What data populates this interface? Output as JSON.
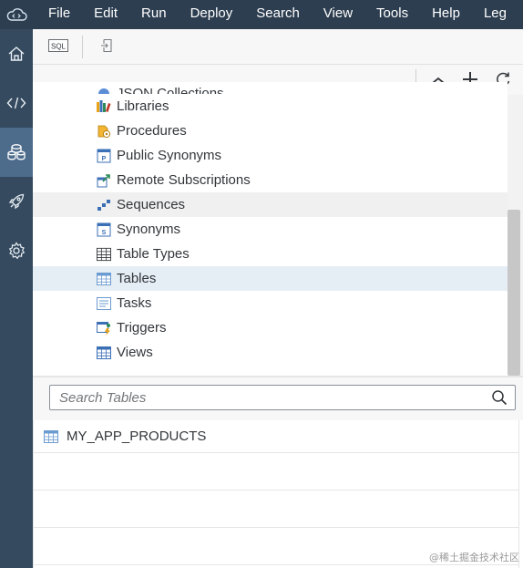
{
  "menubar": {
    "logo_icon": "cloud-code-icon",
    "items": [
      "File",
      "Edit",
      "Run",
      "Deploy",
      "Search",
      "View",
      "Tools",
      "Help",
      "Leg"
    ]
  },
  "sidenav": {
    "items": [
      {
        "icon": "home-icon"
      },
      {
        "icon": "code-icon"
      },
      {
        "icon": "database-explorer-icon",
        "active": true
      },
      {
        "icon": "rocket-icon"
      },
      {
        "icon": "settings-gear-icon"
      }
    ]
  },
  "toolbar": {
    "sql_button_label": "SQL",
    "icons": [
      "sql-console-icon",
      "open-icon"
    ]
  },
  "actionbar": {
    "icons": [
      "collapse-icon",
      "add-icon",
      "refresh-icon"
    ]
  },
  "tree": {
    "clipped_label": "JSON Collections",
    "items": [
      {
        "label": "Libraries",
        "icon": "library-icon"
      },
      {
        "label": "Procedures",
        "icon": "procedure-icon"
      },
      {
        "label": "Public Synonyms",
        "icon": "synonym-icon"
      },
      {
        "label": "Remote Subscriptions",
        "icon": "remote-subscription-icon"
      },
      {
        "label": "Sequences",
        "icon": "sequence-icon"
      },
      {
        "label": "Synonyms",
        "icon": "synonym-icon"
      },
      {
        "label": "Table Types",
        "icon": "table-type-icon"
      },
      {
        "label": "Tables",
        "icon": "table-icon"
      },
      {
        "label": "Tasks",
        "icon": "task-icon"
      },
      {
        "label": "Triggers",
        "icon": "trigger-icon"
      },
      {
        "label": "Views",
        "icon": "view-icon"
      }
    ]
  },
  "search": {
    "placeholder": "Search Tables",
    "value": ""
  },
  "results": {
    "rows": [
      "MY_APP_PRODUCTS"
    ]
  },
  "watermark": "@稀土掘金技术社区",
  "colors": {
    "menubar_bg": "#2c3e50",
    "sidenav_bg": "#354a5f",
    "sidenav_active": "#4d6c8c",
    "selected_row": "#e6eef5"
  }
}
